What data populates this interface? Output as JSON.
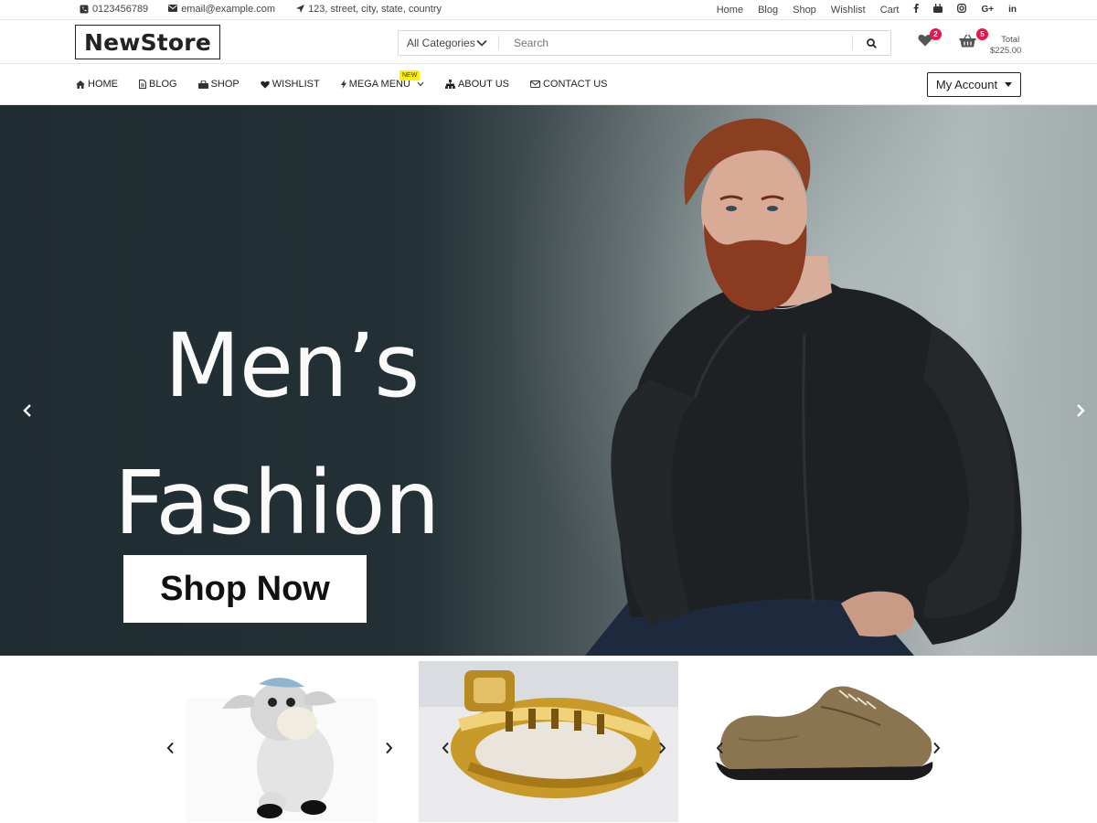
{
  "topbar": {
    "phone": "0123456789",
    "email": "email@example.com",
    "address": "123, street, city, state, country",
    "links": [
      "Home",
      "Blog",
      "Shop",
      "Wishlist",
      "Cart"
    ],
    "social": [
      "f",
      "yt",
      "ig",
      "G+",
      "in"
    ]
  },
  "header": {
    "logo": "NewStore",
    "category_select": "All Categories",
    "search_placeholder": "Search",
    "wishlist_count": "2",
    "cart_count": "5",
    "total_label": "Total",
    "total_value": "$225.00"
  },
  "nav": {
    "items": [
      {
        "label": "HOME",
        "icon": "home-icon"
      },
      {
        "label": "BLOG",
        "icon": "file-icon"
      },
      {
        "label": "SHOP",
        "icon": "bag-icon"
      },
      {
        "label": "WISHLIST",
        "icon": "heart-icon"
      },
      {
        "label": "MEGA MENU",
        "icon": "bolt-icon"
      },
      {
        "label": "ABOUT US",
        "icon": "sitemap-icon"
      },
      {
        "label": "CONTACT US",
        "icon": "envelope-icon"
      }
    ],
    "new_badge": "NEW",
    "account_label": "My Account"
  },
  "hero": {
    "title_line1": "Men’s",
    "title_line2": "Fashion",
    "cta": "Shop Now"
  },
  "colors": {
    "badge": "#e8174b",
    "new_tag": "#fff200",
    "hero_dark": "#1f2c31"
  }
}
